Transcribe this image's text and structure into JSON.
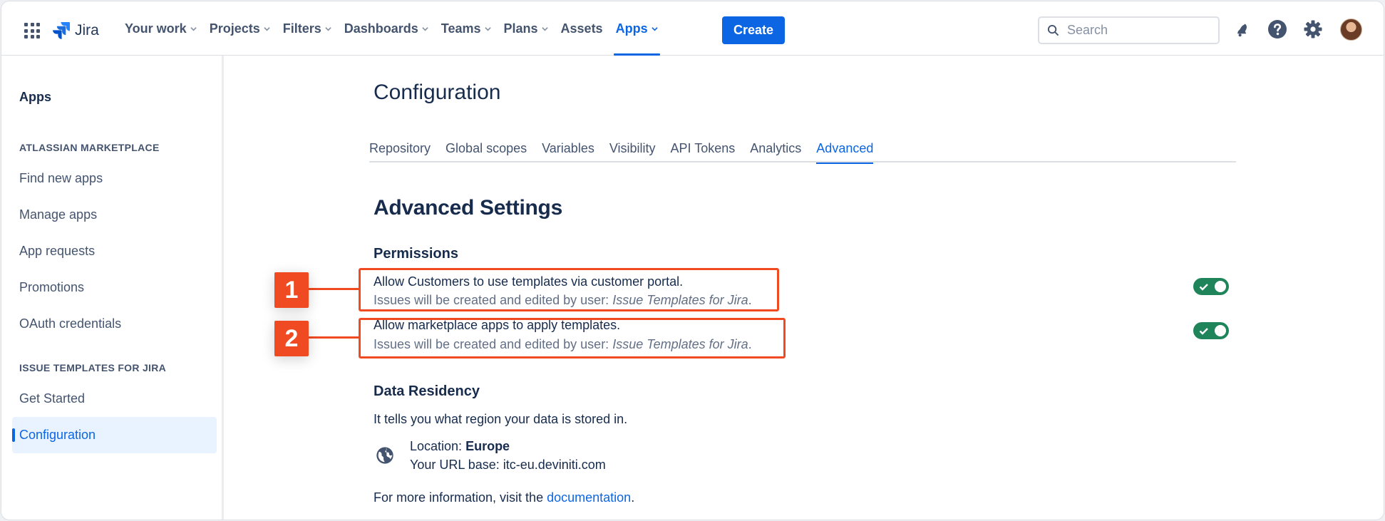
{
  "topnav": {
    "product": "Jira",
    "items": [
      {
        "label": "Your work",
        "dropdown": true
      },
      {
        "label": "Projects",
        "dropdown": true
      },
      {
        "label": "Filters",
        "dropdown": true
      },
      {
        "label": "Dashboards",
        "dropdown": true
      },
      {
        "label": "Teams",
        "dropdown": true
      },
      {
        "label": "Plans",
        "dropdown": true
      },
      {
        "label": "Assets",
        "dropdown": false
      },
      {
        "label": "Apps",
        "dropdown": true,
        "active": true
      }
    ],
    "create_label": "Create",
    "search_placeholder": "Search",
    "icons": [
      "app-switcher-icon",
      "notifications-icon",
      "help-icon",
      "settings-icon",
      "avatar"
    ]
  },
  "sidebar": {
    "title": "Apps",
    "section1": "ATLASSIAN MARKETPLACE",
    "items1": [
      "Find new apps",
      "Manage apps",
      "App requests",
      "Promotions",
      "OAuth credentials"
    ],
    "section2": "ISSUE TEMPLATES FOR JIRA",
    "items2": [
      "Get Started",
      "Configuration"
    ],
    "active_item": "Configuration"
  },
  "main": {
    "title": "Configuration",
    "tabs": [
      "Repository",
      "Global scopes",
      "Variables",
      "Visibility",
      "API Tokens",
      "Analytics",
      "Advanced"
    ],
    "active_tab": "Advanced",
    "heading": "Advanced Settings",
    "permissions": {
      "heading": "Permissions",
      "items": [
        {
          "label": "Allow Customers to use templates via customer portal.",
          "sub_prefix": "Issues will be created and edited by user: ",
          "sub_user": "Issue Templates for Jira",
          "sub_suffix": ".",
          "enabled": true,
          "callout": "1"
        },
        {
          "label": "Allow marketplace apps to apply templates.",
          "sub_prefix": "Issues will be created and edited by user: ",
          "sub_user": "Issue Templates for Jira",
          "sub_suffix": ".",
          "enabled": true,
          "callout": "2"
        }
      ]
    },
    "data_residency": {
      "heading": "Data Residency",
      "description": "It tells you what region your data is stored in.",
      "location_label": "Location: ",
      "location_value": "Europe",
      "url_label": "Your URL base: ",
      "url_value": "itc-eu.deviniti.com",
      "more_info_prefix": "For more information, visit the ",
      "more_info_link": "documentation",
      "more_info_suffix": "."
    }
  },
  "colors": {
    "accent": "#0c66e4",
    "toggle_on": "#1f845a",
    "callout": "#f04a22",
    "text": "#172b4d",
    "subtle_text": "#626f86"
  }
}
